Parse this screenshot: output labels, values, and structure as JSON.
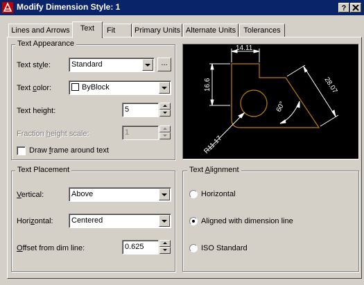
{
  "window": {
    "title": "Modify Dimension Style: 1",
    "help_label": "?",
    "close_label": "X"
  },
  "tabs": [
    {
      "label": "Lines and Arrows"
    },
    {
      "label": "Text",
      "active": true
    },
    {
      "label": "Fit"
    },
    {
      "label": "Primary Units"
    },
    {
      "label": "Alternate Units"
    },
    {
      "label": "Tolerances"
    }
  ],
  "text_appearance": {
    "title": "Text Appearance",
    "text_style_label": "Text style:",
    "text_style_value": "Standard",
    "browse_label": "...",
    "text_color_label": "Text color:",
    "text_color_value": "ByBlock",
    "text_height_label": "Text height:",
    "text_height_value": "5",
    "fraction_height_label": "Fraction height scale:",
    "fraction_height_value": "1",
    "draw_frame_label": "Draw frame around text",
    "draw_frame_checked": false
  },
  "text_placement": {
    "title": "Text Placement",
    "vertical_label": "Vertical:",
    "vertical_value": "Above",
    "horizontal_label": "Horizontal:",
    "horizontal_value": "Centered",
    "offset_label": "Offset from dim line:",
    "offset_value": "0.625"
  },
  "text_alignment": {
    "title": "Text Alignment",
    "options": [
      {
        "label": "Horizontal",
        "selected": false
      },
      {
        "label": "Aligned with dimension line",
        "selected": true
      },
      {
        "label": "ISO Standard",
        "selected": false
      }
    ]
  },
  "preview": {
    "dim_top": "14.11",
    "dim_left": "16.6",
    "dim_right": "28.07",
    "dim_angle": "60°",
    "dim_radius": "R11.17",
    "colors": {
      "background": "#000000",
      "geometry": "#c08000",
      "dims": "#ffffff"
    }
  }
}
